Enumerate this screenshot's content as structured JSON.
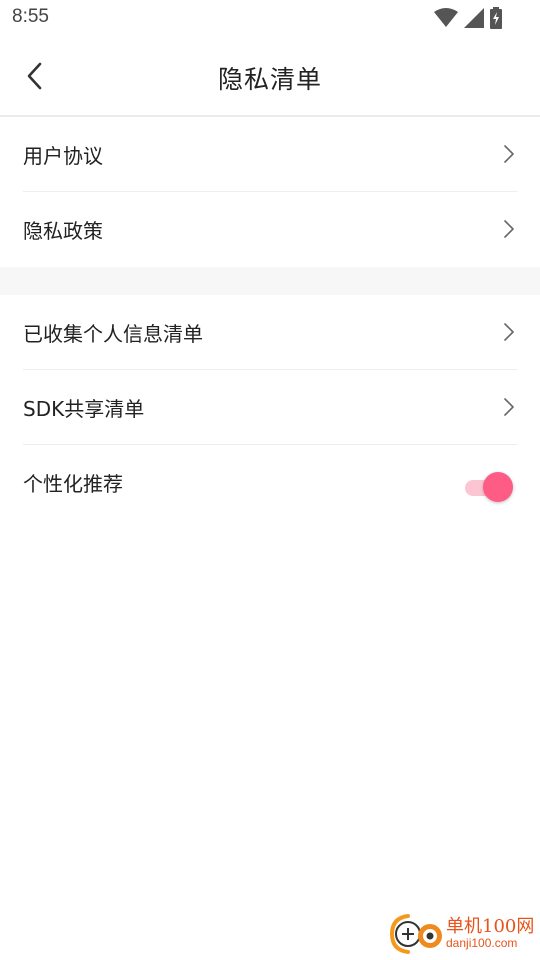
{
  "status_bar": {
    "time": "8:55"
  },
  "header": {
    "title": "隐私清单"
  },
  "group1": [
    {
      "label": "用户协议"
    },
    {
      "label": "隐私政策"
    }
  ],
  "group2": [
    {
      "label": "已收集个人信息清单"
    },
    {
      "label": "SDK共享清单"
    }
  ],
  "personalized": {
    "label": "个性化推荐",
    "enabled": true
  },
  "colors": {
    "accent": "#ff5c85",
    "accent_light": "#fbc6d2",
    "divider": "#eeeeee",
    "section_gap": "#f7f7f7"
  },
  "watermark": {
    "line1": "单机100网",
    "line2": "danji100.com"
  }
}
